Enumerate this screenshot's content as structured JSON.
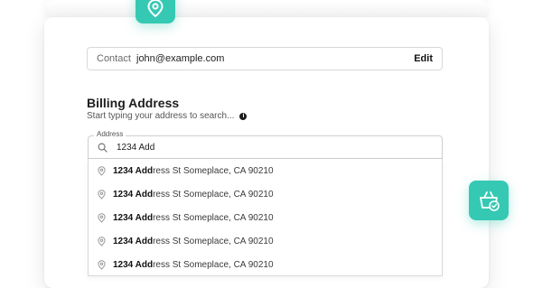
{
  "contact": {
    "label": "Contact",
    "value": "john@example.com",
    "edit_label": "Edit"
  },
  "billing": {
    "title": "Billing Address",
    "subtitle": "Start typing your address to search..."
  },
  "address": {
    "legend": "Address",
    "value": "1234 Add"
  },
  "suggestions": [
    {
      "match": "1234 Add",
      "rest": "ress St Someplace, CA 90210"
    },
    {
      "match": "1234 Add",
      "rest": "ress St Someplace, CA 90210"
    },
    {
      "match": "1234 Add",
      "rest": "ress St Someplace, CA 90210"
    },
    {
      "match": "1234 Add",
      "rest": "ress St Someplace, CA 90210"
    },
    {
      "match": "1234 Add",
      "rest": "ress St Someplace, CA 90210"
    }
  ],
  "colors": {
    "accent": "#35c9b3"
  },
  "icons": {
    "top_fab": "map-pin-icon",
    "side_fab": "basket-check-icon",
    "search": "search-icon",
    "info": "info-icon",
    "suggestion": "location-pin-icon"
  }
}
